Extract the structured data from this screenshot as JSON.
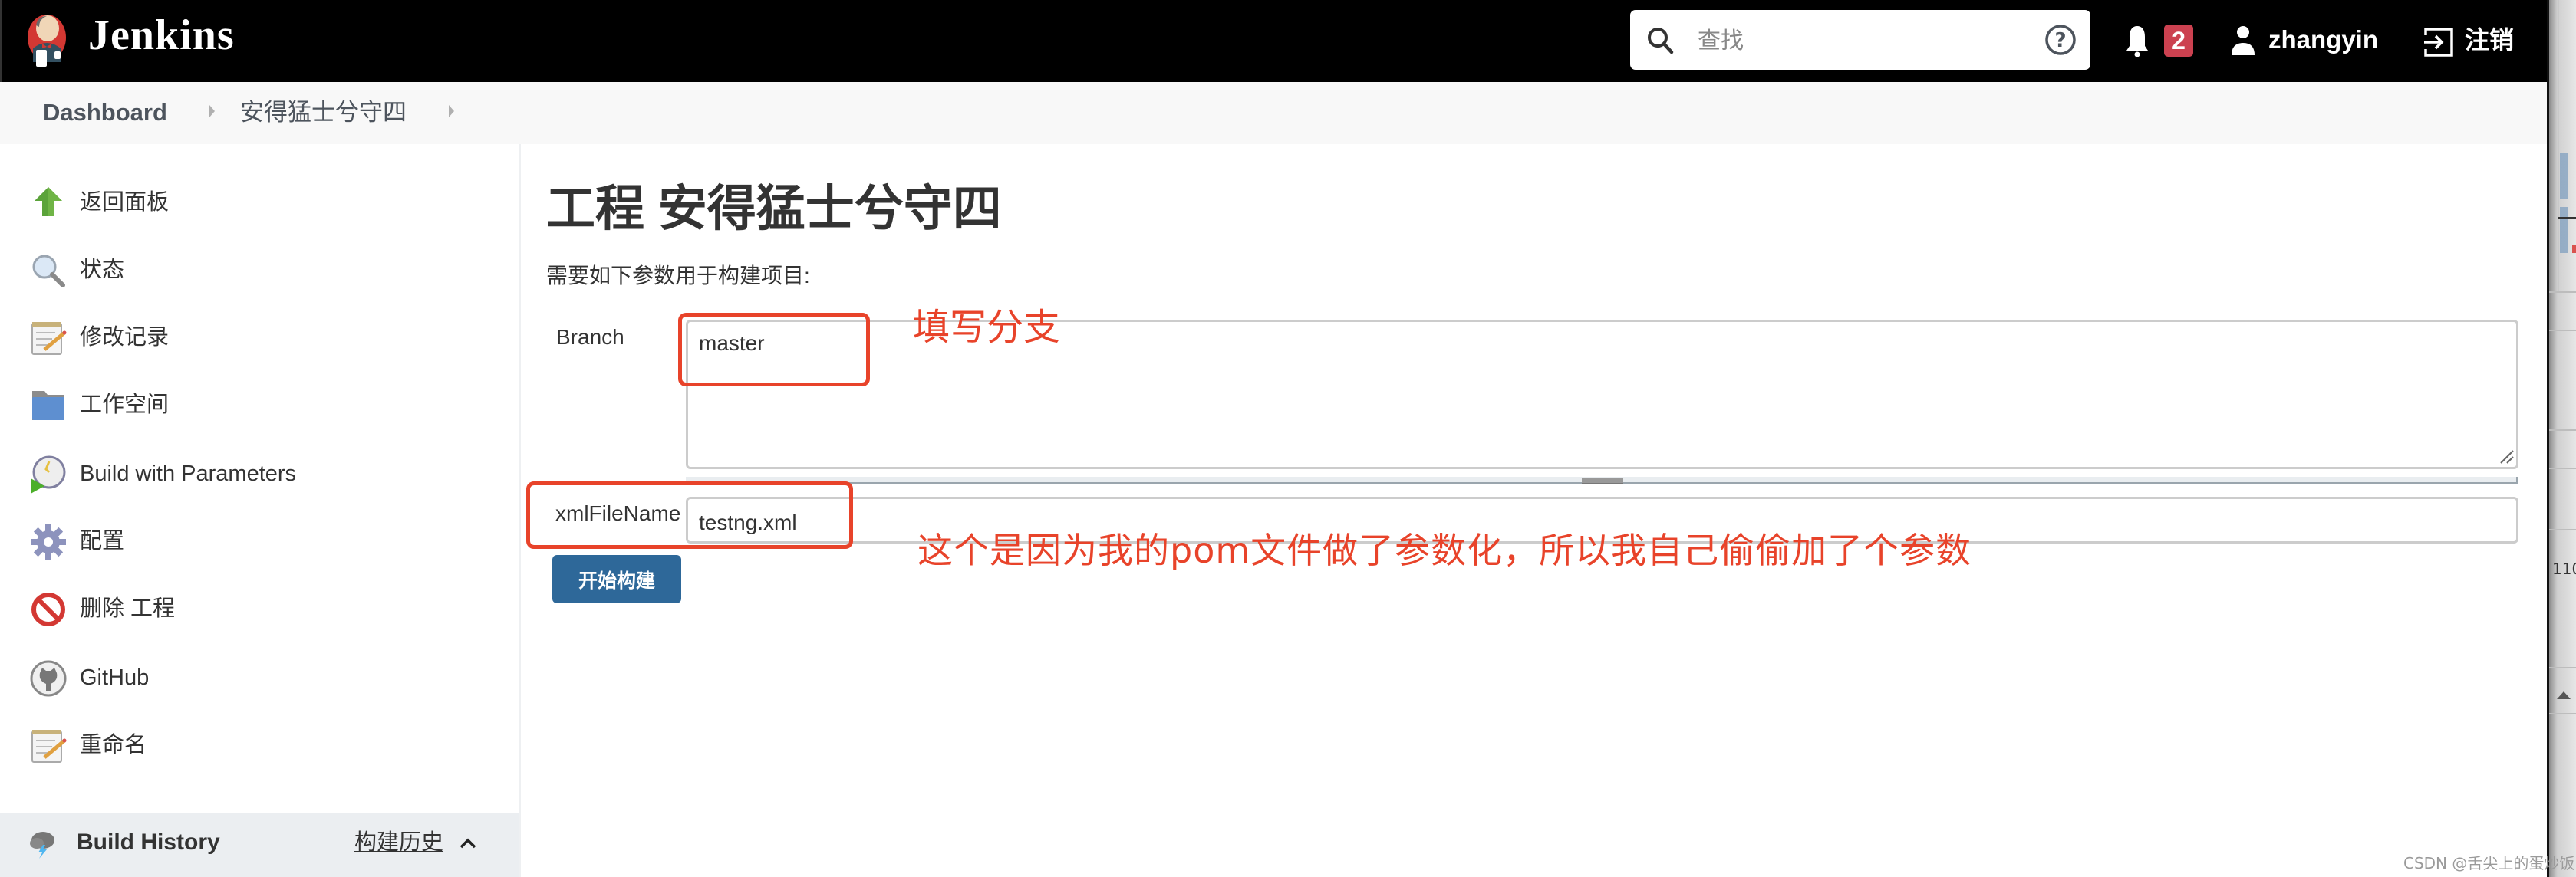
{
  "header": {
    "brand": "Jenkins",
    "search_placeholder": "查找",
    "notification_count": "2",
    "username": "zhangyin",
    "logout_label": "注销"
  },
  "breadcrumb": {
    "items": [
      "Dashboard",
      "安得猛士兮守四"
    ]
  },
  "sidebar": {
    "items": [
      {
        "label": "返回面板",
        "icon": "up-arrow-icon"
      },
      {
        "label": "状态",
        "icon": "magnifier-icon"
      },
      {
        "label": "修改记录",
        "icon": "notepad-icon"
      },
      {
        "label": "工作空间",
        "icon": "folder-icon"
      },
      {
        "label": "Build with Parameters",
        "icon": "clock-play-icon"
      },
      {
        "label": "配置",
        "icon": "gear-icon"
      },
      {
        "label": "删除 工程",
        "icon": "no-entry-icon"
      },
      {
        "label": "GitHub",
        "icon": "github-icon"
      },
      {
        "label": "重命名",
        "icon": "notepad-icon"
      }
    ],
    "build_history": {
      "title": "Build History",
      "link": "构建历史"
    }
  },
  "main": {
    "title": "工程 安得猛士兮守四",
    "description": "需要如下参数用于构建项目:",
    "params": [
      {
        "name": "Branch",
        "value": "master",
        "type": "textarea"
      },
      {
        "name": "xmlFileName",
        "value": "testng.xml",
        "type": "text"
      }
    ],
    "build_button": "开始构建"
  },
  "annotations": {
    "note1": "填写分支",
    "note2": "这个是因为我的pom文件做了参数化，所以我自己偷偷加了个参数",
    "color": "#e8432a"
  },
  "background_window": {
    "text": "110"
  },
  "watermark": "CSDN @舌尖上的蛋炒饭",
  "colors": {
    "header_bg": "#000000",
    "badge": "#cc4150",
    "build_button": "#2e6899",
    "breadcrumb_bg": "#f8f8f8",
    "build_history_bg": "#ebeef1"
  }
}
